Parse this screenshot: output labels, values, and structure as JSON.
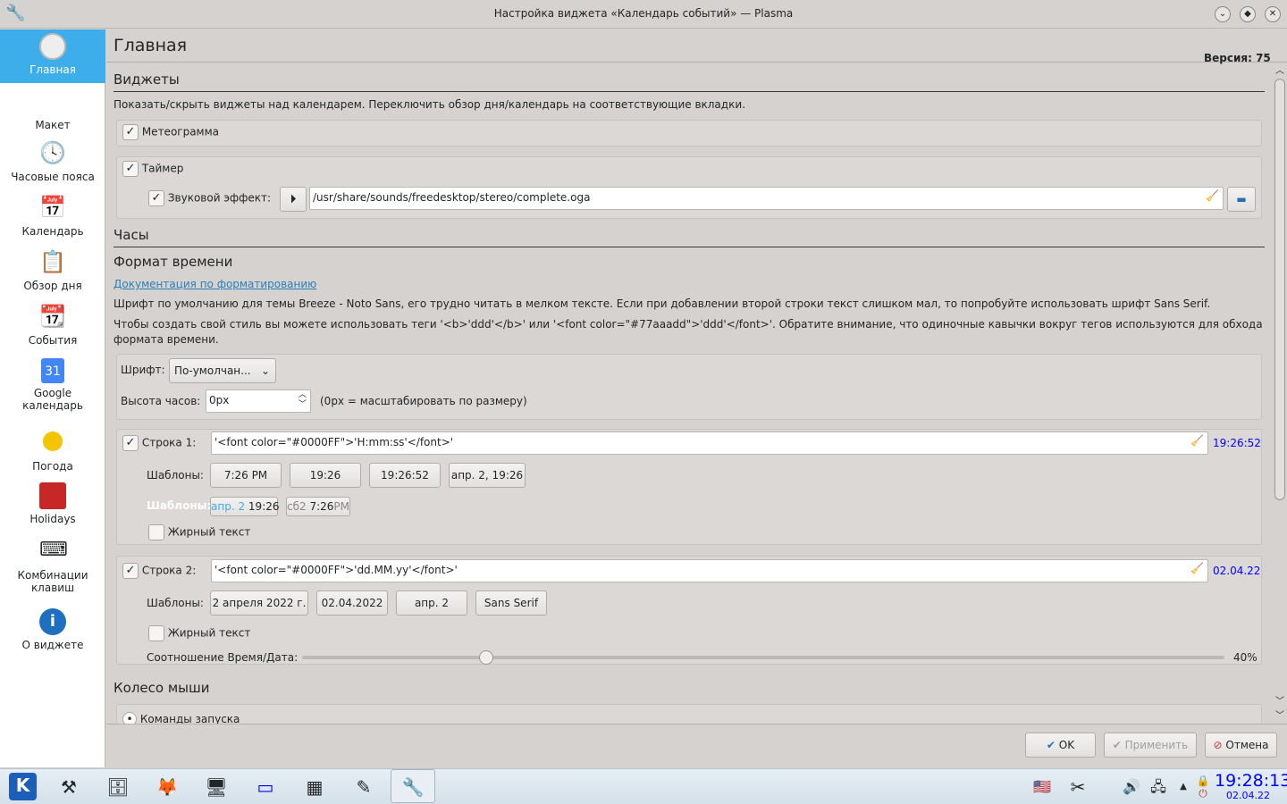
{
  "window": {
    "title": "Настройка виджета «Календарь событий» — Plasma"
  },
  "sidebar": {
    "items": [
      {
        "label": "Главная"
      },
      {
        "label": "Макет"
      },
      {
        "label": "Часовые пояса"
      },
      {
        "label": "Календарь"
      },
      {
        "label": "Обзор дня"
      },
      {
        "label": "События"
      },
      {
        "label": "Google календарь"
      },
      {
        "label": "Погода"
      },
      {
        "label": "Holidays"
      },
      {
        "label": "Комбинации клавиш"
      },
      {
        "label": "О виджете"
      }
    ]
  },
  "page": {
    "title": "Главная",
    "version": "Версия: 75"
  },
  "widgets": {
    "heading": "Виджеты",
    "description": "Показать/скрыть виджеты над календарем. Переключить обзор дня/календарь на соответствующие вкладки.",
    "meteogram": "Метеограмма",
    "timer": "Таймер",
    "sound_effect": "Звуковой эффект:",
    "sound_path": "/usr/share/sounds/freedesktop/stereo/complete.oga"
  },
  "clock": {
    "heading": "Часы",
    "format_heading": "Формат времени",
    "doc_link": "Документация по форматированию",
    "info1": "Шрифт по умолчанию для темы Breeze - Noto Sans, его трудно читать в мелком тексте. Если при добавлении второй строки текст слишком мал, то попробуйте использовать шрифт Sans Serif.",
    "info2": "Чтобы создать свой стиль вы можете использовать теги '<b>'ddd'</b>' или '<font color=\"#77aaadd\">'ddd'</font>'. Обратите внимание, что одиночные кавычки вокруг тегов используются для обхода формата времени.",
    "font_label": "Шрифт:",
    "font_value": "По-умолчан...",
    "height_label": "Высота часов:",
    "height_value": "0px",
    "height_hint": "(0px = масштабировать по размеру)"
  },
  "line1": {
    "label": "Строка 1:",
    "value": "'<font color=\"#0000FF\">'H:mm:ss'</font>'",
    "preview": "19:26:52",
    "templates_label": "Шаблоны:",
    "templates": [
      "7:26 PM",
      "19:26",
      "19:26:52",
      "апр. 2, 19:26"
    ],
    "templates2_label": "Шаблоны:",
    "t2a_date": "апр. 2",
    "t2a_time": "19:26",
    "t2b_day": "сб2",
    "t2b_time": "7:26",
    "t2b_pm": "PM",
    "bold": "Жирный текст"
  },
  "line2": {
    "label": "Строка 2:",
    "value": "'<font color=\"#0000FF\">'dd.MM.yy'</font>'",
    "preview": "02.04.22",
    "templates_label": "Шаблоны:",
    "templates": [
      "2 апреля 2022 г.",
      "02.04.2022",
      "апр. 2",
      "Sans Serif"
    ],
    "bold": "Жирный текст"
  },
  "ratio": {
    "label": "Соотношение Время/Дата:",
    "value_text": "40%",
    "value": 0.2
  },
  "mouse": {
    "heading": "Колесо мыши",
    "launch": "Команды запуска"
  },
  "buttons": {
    "ok": "OK",
    "apply": "Применить",
    "cancel": "Отмена"
  },
  "tray": {
    "time": "19:28:13",
    "date": "02.04.22"
  },
  "colors": {
    "accent": "#3daee9",
    "blue": "#0000ff"
  }
}
